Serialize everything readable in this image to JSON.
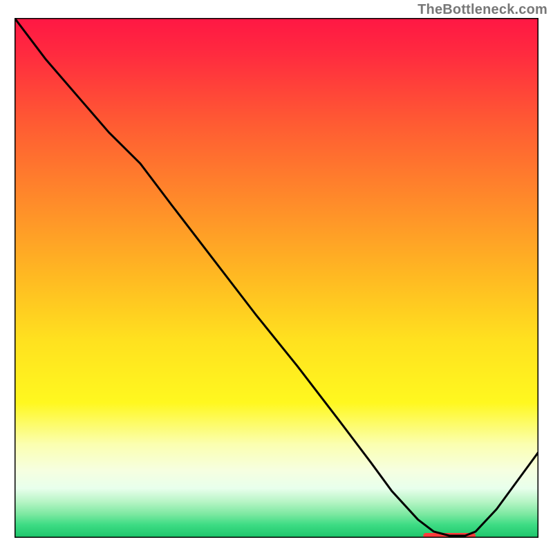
{
  "watermark": "TheBottleneck.com",
  "chart_data": {
    "type": "line",
    "title": "",
    "xlabel": "",
    "ylabel": "",
    "xlim": [
      0,
      100
    ],
    "ylim": [
      0,
      100
    ],
    "gradient_stops": [
      {
        "offset": 0,
        "color": "#ff1744"
      },
      {
        "offset": 0.07,
        "color": "#ff2b3f"
      },
      {
        "offset": 0.2,
        "color": "#ff5a33"
      },
      {
        "offset": 0.35,
        "color": "#ff8a2a"
      },
      {
        "offset": 0.5,
        "color": "#ffba22"
      },
      {
        "offset": 0.62,
        "color": "#ffe11f"
      },
      {
        "offset": 0.74,
        "color": "#fff81f"
      },
      {
        "offset": 0.82,
        "color": "#fbffb0"
      },
      {
        "offset": 0.87,
        "color": "#f6ffe0"
      },
      {
        "offset": 0.905,
        "color": "#e8ffec"
      },
      {
        "offset": 0.93,
        "color": "#b8f5c6"
      },
      {
        "offset": 0.955,
        "color": "#7be8a0"
      },
      {
        "offset": 0.975,
        "color": "#3ddc84"
      },
      {
        "offset": 1.0,
        "color": "#1cc46a"
      }
    ],
    "series": [
      {
        "name": "curve",
        "color": "#000000",
        "x": [
          0,
          6,
          12,
          18,
          24,
          25.5,
          30,
          38,
          46,
          54,
          62,
          68,
          72,
          77,
          80,
          83,
          86,
          88,
          92,
          96,
          100
        ],
        "y": [
          100,
          92,
          85,
          78,
          72,
          70,
          64,
          53.5,
          43,
          33,
          22.5,
          14.5,
          9,
          3.5,
          1.2,
          0.4,
          0.4,
          1.2,
          5.5,
          11,
          16.5
        ]
      }
    ],
    "highlight_bar": {
      "x_start": 78,
      "x_end": 88,
      "y": 0.4,
      "color": "#ff3b3b"
    }
  }
}
